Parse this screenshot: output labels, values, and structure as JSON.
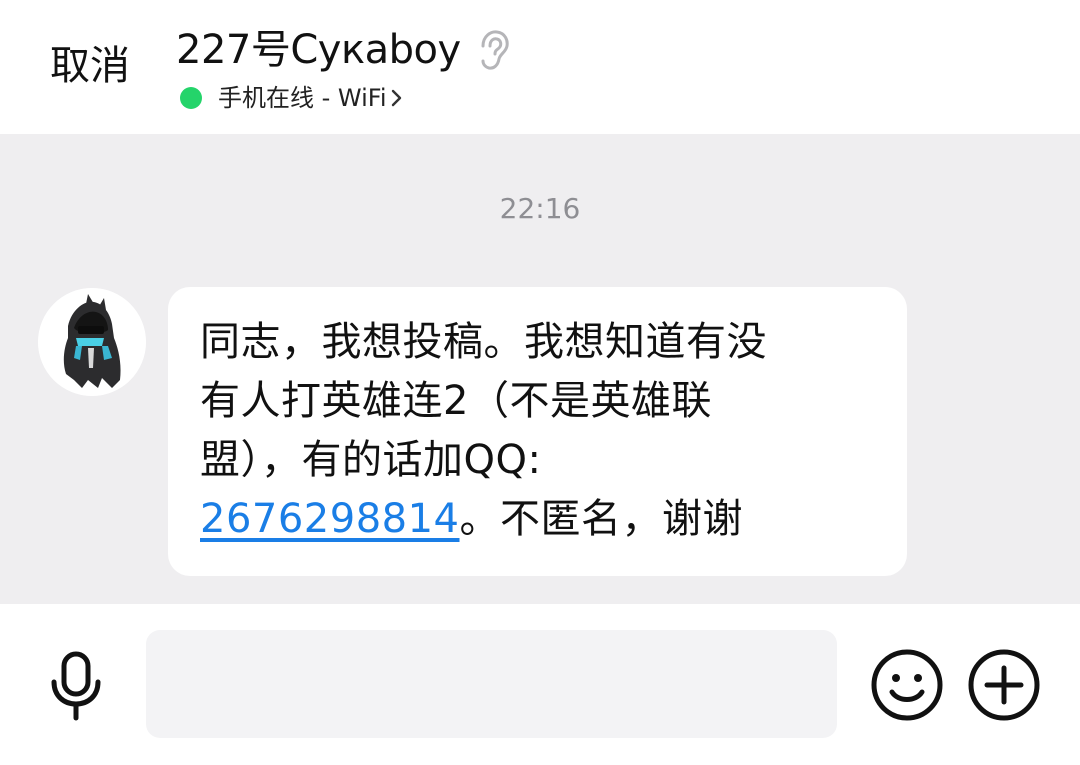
{
  "header": {
    "cancel_label": "取消",
    "contact_name": "227号Cyкaboy",
    "status_text": "手机在线 - WiFi",
    "status_color": "#24d46a"
  },
  "chat": {
    "timestamp": "22:16",
    "message": {
      "line1": "同志，我想投稿。我想知道有没",
      "line2": "有人打英雄连2（不是英雄联",
      "line3": "盟），有的话加QQ:",
      "link": "2676298814",
      "tail": "。不匿名，谢谢"
    }
  },
  "input_bar": {
    "placeholder": "",
    "icons": [
      "microphone-icon",
      "emoji-icon",
      "plus-icon"
    ]
  },
  "colors": {
    "link": "#1a7ee6",
    "chat_background": "#efeef0"
  }
}
